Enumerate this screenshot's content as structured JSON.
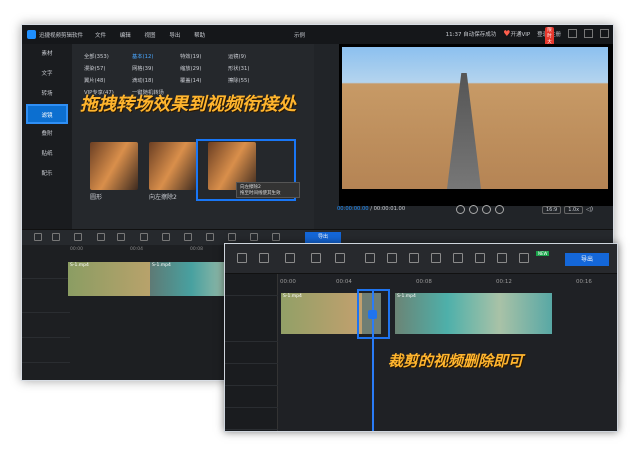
{
  "app": {
    "title": "迅捷视频剪辑软件",
    "menu": [
      "文件",
      "编辑",
      "视图",
      "导出",
      "帮助"
    ],
    "project": "示例",
    "autosave": "11:37 自动保存成功",
    "vip_label": "开通VIP",
    "vip_badge": "限时大促",
    "login": "登录/注册"
  },
  "sidebar": {
    "items": [
      "素材",
      "文字",
      "转场",
      "滤镜",
      "叠附",
      "贴纸",
      "配乐"
    ],
    "active": "转场"
  },
  "panel": {
    "tabs": [
      "全部(353)",
      "基本(12)",
      "特效(19)",
      "运镜(9)",
      "漫染(57)",
      "网格(39)",
      "缩放(29)",
      "形状(31)",
      "翼片(48)",
      "滴动(18)",
      "覆盖(14)",
      "擦除(55)",
      "VIP专享(47)",
      "一键随机转场"
    ],
    "active_tab": "基本(12)",
    "thumb_labels": [
      "圆形",
      "向左擦除2",
      "",
      ""
    ],
    "tooltip": [
      "向左擦除2",
      "拖至时间线使其生效"
    ]
  },
  "player": {
    "current": "00:00:00.00",
    "total": "00:00:01.00",
    "ratio": "16:9",
    "speed": "1.0x"
  },
  "timeline": {
    "export_label": "导出",
    "ruler": [
      "00:00",
      "00:04",
      "00:08",
      "00:12",
      "00:16",
      "00:20",
      "00:24",
      "00:28",
      "00:32"
    ],
    "clips": [
      "S-1.mp4",
      "S-1.mp4"
    ]
  },
  "overlay": {
    "export_label": "导出",
    "new_badge": "NEW",
    "ruler": [
      "00:00",
      "00:04",
      "00:08",
      "00:12",
      "00:16"
    ],
    "clips": [
      "S-1.mp4",
      "S-1.mp4"
    ]
  },
  "captions": {
    "top": "拖拽转场效果到视频衔接处",
    "bottom": "裁剪的视频删除即可"
  },
  "colors": {
    "accent": "#1e8fff",
    "caption": "#ffb52e",
    "selection": "#1f74f0"
  }
}
